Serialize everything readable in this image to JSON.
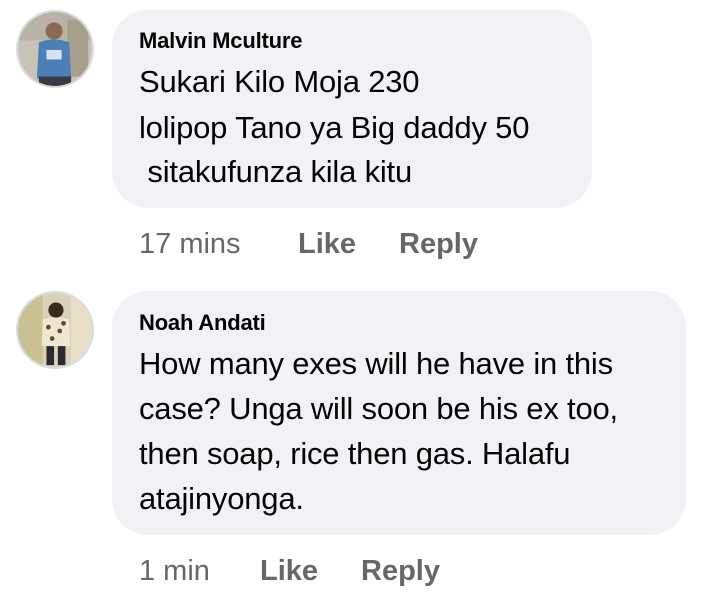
{
  "comments": [
    {
      "author": "Malvin Mculture",
      "lines": [
        "Sukari Kilo Moja 230",
        "lolipop Tano ya Big daddy 50",
        " sitakufunza kila kitu"
      ],
      "time": "17 mins",
      "like_label": "Like",
      "reply_label": "Reply",
      "avatar_icon": "profile-photo"
    },
    {
      "author": "Noah Andati",
      "lines": [
        "How many exes will he have in this",
        "case? Unga will soon be his ex too,",
        "then soap, rice then gas. Halafu",
        "atajinyonga."
      ],
      "time": "1 min",
      "like_label": "Like",
      "reply_label": "Reply",
      "avatar_icon": "profile-photo"
    }
  ],
  "colors": {
    "bubble": "#f0f2f5",
    "text": "#050505",
    "meta": "#65676b"
  }
}
